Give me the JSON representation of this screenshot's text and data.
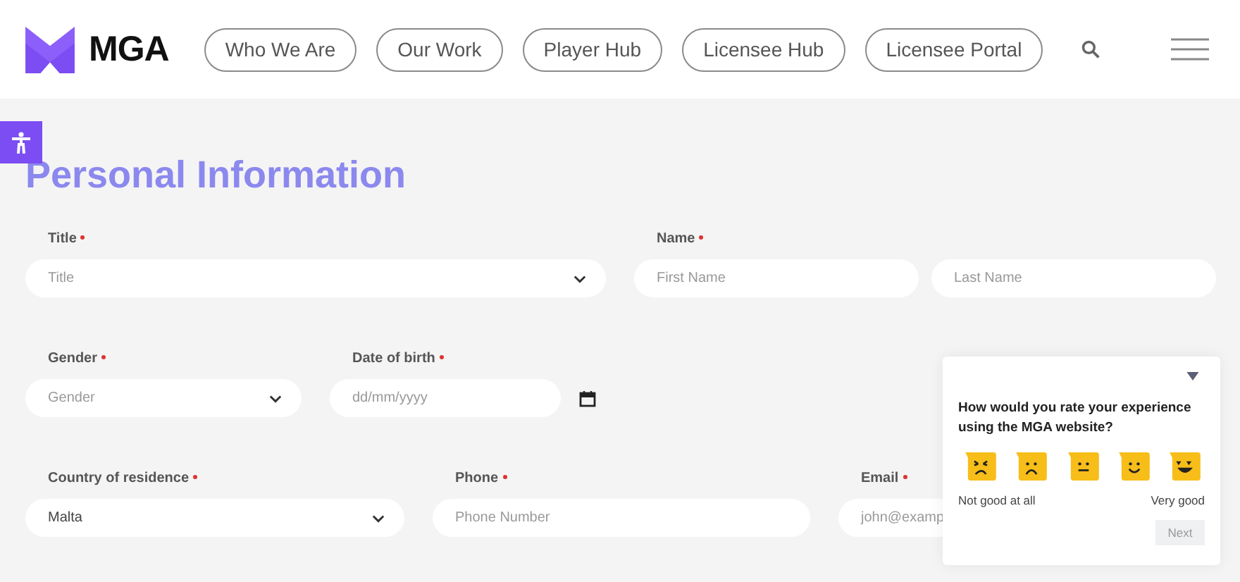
{
  "header": {
    "logo": "MGA",
    "nav": [
      {
        "label": "Who We Are"
      },
      {
        "label": "Our Work"
      },
      {
        "label": "Player Hub"
      },
      {
        "label": "Licensee Hub"
      },
      {
        "label": "Licensee Portal"
      }
    ]
  },
  "page_title": "Personal Information",
  "rows": [
    {
      "fields": [
        {
          "label": "Title",
          "required": true,
          "inputs": [
            {
              "kind": "select",
              "placeholder": "Title"
            }
          ]
        },
        {
          "label": "Name",
          "required": true,
          "inputs": [
            {
              "kind": "text",
              "placeholder": "First Name"
            },
            {
              "kind": "text",
              "placeholder": "Last Name"
            }
          ]
        }
      ]
    },
    {
      "fields": [
        {
          "label": "Gender",
          "required": true,
          "inputs": [
            {
              "kind": "select",
              "placeholder": "Gender"
            }
          ]
        },
        {
          "label": "Date of birth",
          "required": true,
          "inputs": [
            {
              "kind": "date",
              "placeholder": "dd/mm/yyyy"
            }
          ]
        }
      ]
    },
    {
      "fields": [
        {
          "label": "Country of residence",
          "required": true,
          "inputs": [
            {
              "kind": "select",
              "value": "Malta"
            }
          ]
        },
        {
          "label": "Phone",
          "required": true,
          "inputs": [
            {
              "kind": "text",
              "placeholder": "Phone Number"
            }
          ]
        },
        {
          "label": "Email",
          "required": true,
          "inputs": [
            {
              "kind": "text",
              "placeholder": "john@examp"
            }
          ]
        }
      ]
    }
  ],
  "survey": {
    "question": "How would you rate your experience using the MGA website?",
    "ratings": [
      {
        "kind": "angry"
      },
      {
        "kind": "sad"
      },
      {
        "kind": "neutral"
      },
      {
        "kind": "happy"
      },
      {
        "kind": "love"
      }
    ],
    "low_label": "Not good at all",
    "high_label": "Very good",
    "next_button": "Next"
  }
}
